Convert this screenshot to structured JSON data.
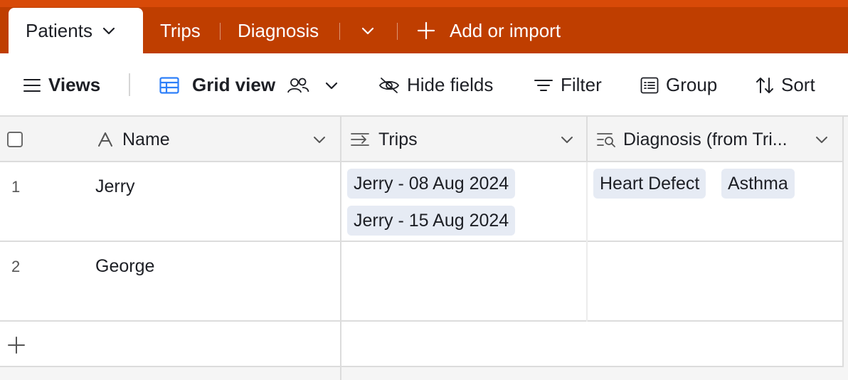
{
  "tabs": {
    "active": "Patients",
    "items": [
      "Trips",
      "Diagnosis"
    ],
    "add": "Add or import"
  },
  "toolbar": {
    "views": "Views",
    "grid_view": "Grid view",
    "hide_fields": "Hide fields",
    "filter": "Filter",
    "group": "Group",
    "sort": "Sort"
  },
  "columns": {
    "name": "Name",
    "trips": "Trips",
    "diagnosis": "Diagnosis (from Tri..."
  },
  "rows": [
    {
      "num": "1",
      "name": "Jerry",
      "trips": [
        "Jerry - 08 Aug 2024",
        "Jerry - 15 Aug 2024"
      ],
      "diagnosis": [
        "Heart Defect",
        "Asthma"
      ]
    },
    {
      "num": "2",
      "name": "George",
      "trips": [],
      "diagnosis": []
    }
  ],
  "colors": {
    "tabbar": "#bf3e00",
    "tabbar_top": "#d84a08",
    "chip": "#e6ebf4",
    "grid_icon": "#2d7ff9"
  }
}
